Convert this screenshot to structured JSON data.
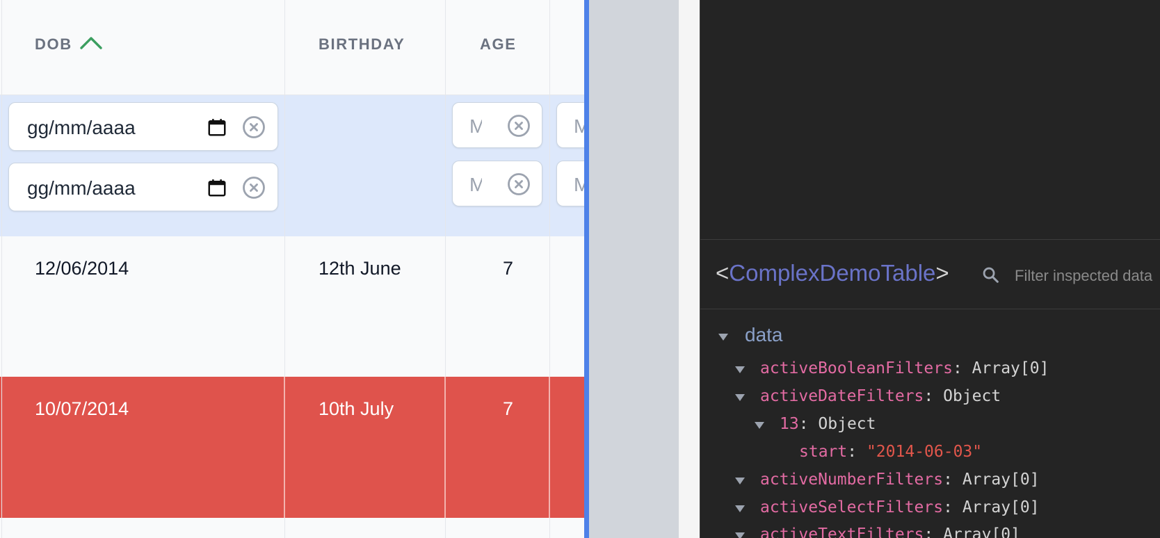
{
  "table": {
    "columns": [
      {
        "label": "DOB",
        "sorted": "ascending"
      },
      {
        "label": "BIRTHDAY"
      },
      {
        "label": "AGE"
      }
    ],
    "date_filters": {
      "start_placeholder": "gg/mm/aaaa",
      "end_placeholder": "gg/mm/aaaa"
    },
    "number_filters": {
      "min_placeholder": "M",
      "max_placeholder": "M",
      "next_min_placeholder": "M",
      "next_max_placeholder": "M"
    },
    "rows": [
      {
        "dob": "12/06/2014",
        "birthday": "12th June",
        "age": "7",
        "highlighted": false
      },
      {
        "dob": "10/07/2014",
        "birthday": "10th July",
        "age": "7",
        "highlighted": true
      }
    ],
    "colors": {
      "sort_arrow": "#3b9e5f",
      "filter_row": "#dde8fb",
      "highlight_row": "#df534c"
    }
  },
  "devtools": {
    "component": {
      "open_bracket": "<",
      "name": "ComplexDemoTable",
      "close_bracket": ">"
    },
    "search_placeholder": "Filter inspected data",
    "section": "data",
    "tree": [
      {
        "key": "activeBooleanFilters",
        "value": "Array[0]"
      },
      {
        "key": "activeDateFilters",
        "value": "Object"
      },
      {
        "key": "13",
        "value": "Object"
      },
      {
        "key": "start",
        "value": "\"2014-06-03\""
      },
      {
        "key": "activeNumberFilters",
        "value": "Array[0]"
      },
      {
        "key": "activeSelectFilters",
        "value": "Array[0]"
      },
      {
        "key": "activeTextFilters",
        "value": "Array[0]"
      }
    ],
    "colors": {
      "component_name": "#6a73c8",
      "key": "#e36ba3",
      "string": "#e2564b"
    }
  }
}
